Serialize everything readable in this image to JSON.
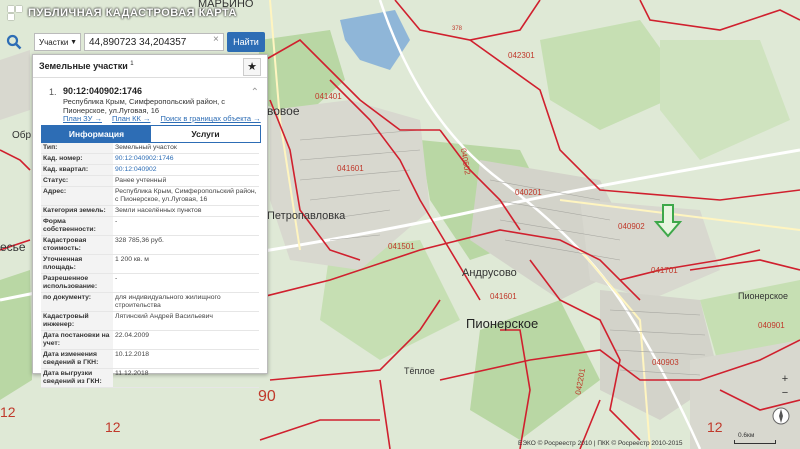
{
  "app": {
    "title": "ПУБЛИЧНАЯ КАДАСТРОВАЯ КАРТА"
  },
  "search": {
    "type_selected": "Участки",
    "query": "44,890723 34,204357",
    "find_label": "Найти"
  },
  "panel": {
    "title": "Земельные участки",
    "title_count": "1",
    "result": {
      "number": "1.",
      "cad_number": "90:12:040902:1746",
      "address": "Республика Крым, Симферопольский район, с Пионерское, ул.Луговая, 16"
    },
    "links": [
      "План ЗУ →",
      "План КК →",
      "Поиск в границах объекта →"
    ],
    "tabs": [
      "Информация",
      "Услуги"
    ],
    "attributes": [
      {
        "key": "Тип:",
        "value": "Земельный участок"
      },
      {
        "key": "Кад. номер:",
        "value": "90:12:040902:1746"
      },
      {
        "key": "Кад. квартал:",
        "value": "90:12:040902"
      },
      {
        "key": "Статус:",
        "value": "Ранее учтенный"
      },
      {
        "key": "Адрес:",
        "value": "Республика Крым, Симферопольский район, с Пионерское, ул.Луговая, 16"
      },
      {
        "key": "Категория земель:",
        "value": "Земли населённых пунктов"
      },
      {
        "key": "Форма собственности:",
        "value": "-"
      },
      {
        "key": "Кадастровая стоимость:",
        "value": "328 785,36 руб."
      },
      {
        "key": "Уточненная площадь:",
        "value": "1 200 кв. м"
      },
      {
        "key": "Разрешенное использование:",
        "value": "-"
      },
      {
        "key": "по документу:",
        "value": "для индивидуального жилищного строительства"
      },
      {
        "key": "Кадастровый инженер:",
        "value": "Лятинский Андрей Васильевич"
      },
      {
        "key": "Дата постановки на учет:",
        "value": "22.04.2009"
      },
      {
        "key": "Дата изменения сведений в ГКН:",
        "value": "10.12.2018"
      },
      {
        "key": "Дата выгрузки сведений из ГКН:",
        "value": "11.12.2018"
      }
    ]
  },
  "map": {
    "places": [
      "МАРЬИНО",
      "Петропавловка",
      "Андрусово",
      "Пионерское",
      "Пионерское",
      "Тёплое",
      "есье",
      "Обр",
      "вовое"
    ],
    "quarters": [
      "042301",
      "041401",
      "041601",
      "040201",
      "040902",
      "041501",
      "041601",
      "041701",
      "040901",
      "040903",
      "040502",
      "042201",
      "378"
    ],
    "regions": [
      "12",
      "90",
      "12",
      "12"
    ],
    "footer": "ЕЭКО © Росреестр 2010 | ПКК © Росреестр 2010-2015",
    "scale_label": "0.6км"
  },
  "colors": {
    "accent": "#2d6db5",
    "boundary": "#d0202e",
    "arrow": "#4caf50"
  }
}
